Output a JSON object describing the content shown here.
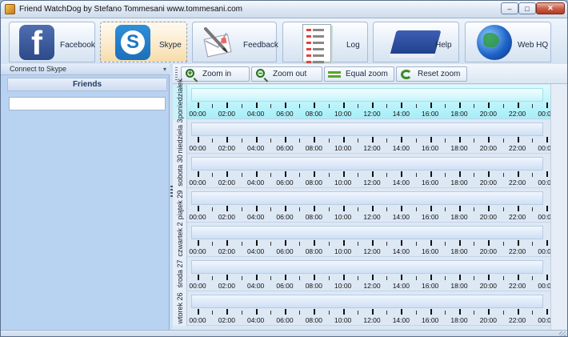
{
  "window": {
    "title": "Friend WatchDog by Stefano Tommesani  www.tommesani.com",
    "minimize": "–",
    "maximize": "□",
    "close": "✕"
  },
  "toolbar": {
    "items": [
      {
        "label": "Facebook",
        "icon": "facebook-icon",
        "active": false
      },
      {
        "label": "Skype",
        "icon": "skype-icon",
        "active": true
      },
      {
        "label": "Feedback",
        "icon": "feedback-icon",
        "active": false
      },
      {
        "label": "Log",
        "icon": "log-icon",
        "active": false
      },
      {
        "label": "Help",
        "icon": "help-book-icon",
        "active": false
      },
      {
        "label": "Web HQ",
        "icon": "globe-icon",
        "active": false
      }
    ]
  },
  "left_panel": {
    "connect_label": "Connect to Skype",
    "friends_header": "Friends",
    "search_value": ""
  },
  "zoom": {
    "zoom_in": "Zoom in",
    "zoom_out": "Zoom out",
    "equal_zoom": "Equal zoom",
    "reset_zoom": "Reset zoom"
  },
  "timeline": {
    "hour_labels": [
      "00:00",
      "02:00",
      "04:00",
      "06:00",
      "08:00",
      "10:00",
      "12:00",
      "14:00",
      "16:00",
      "18:00",
      "20:00",
      "22:00",
      "00:00"
    ],
    "days": [
      {
        "label": "3 poniedziałek",
        "selected": true
      },
      {
        "label": "niedziela 3",
        "selected": false
      },
      {
        "label": "sobota 30",
        "selected": false
      },
      {
        "label": "piątek 29",
        "selected": false
      },
      {
        "label": "czwartek 2",
        "selected": false
      },
      {
        "label": "środa 27",
        "selected": false
      },
      {
        "label": "wtorek 26",
        "selected": false
      }
    ]
  },
  "colors": {
    "selected_row": "#a6eef8",
    "panel": "#b8d2f2",
    "accent": "#2d4a8a"
  }
}
